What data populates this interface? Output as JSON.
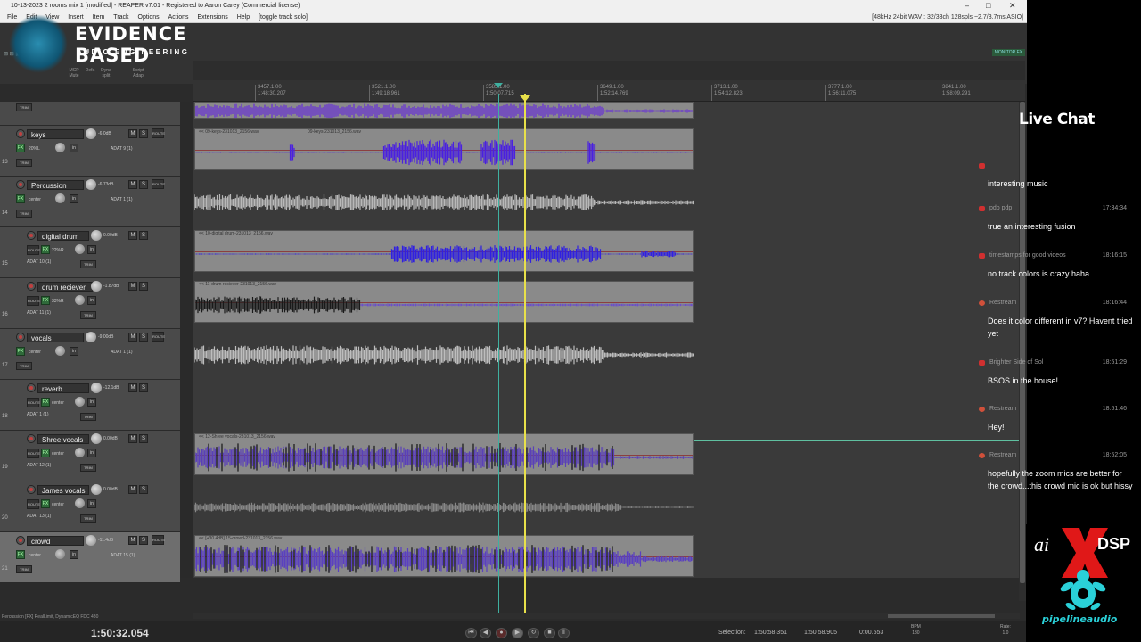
{
  "window": {
    "title": "10-13-2023 2 rooms mix 1 [modified] - REAPER v7.01 - Registered to Aaron Carey (Commercial license)",
    "format": "[48kHz 24bit WAV : 32/33ch 128spls ~2.7/3.7ms ASIO]"
  },
  "menu": [
    "File",
    "Edit",
    "View",
    "Insert",
    "Item",
    "Track",
    "Options",
    "Actions",
    "Extensions",
    "Help",
    "[toggle track solo]"
  ],
  "logo": {
    "title": "EVIDENCE BASED",
    "subtitle": "AUDIO ENGINEERING"
  },
  "toolbar": {
    "labels": [
      "MCP",
      "Mute",
      "Defa",
      "Dyna split",
      "Script Adap"
    ],
    "monitor": "MONITOR FX"
  },
  "ruler": [
    {
      "bar": "3457.1.00",
      "time": "1:48:30.207"
    },
    {
      "bar": "3521.1.00",
      "time": "1:49:18.961"
    },
    {
      "bar": "3585.1.00",
      "time": "1:50:07.715"
    },
    {
      "bar": "3649.1.00",
      "time": "1:52:14.769"
    },
    {
      "bar": "3713.1.00",
      "time": "1:54:12.823"
    },
    {
      "bar": "3777.1.00",
      "time": "1:56:11.075"
    },
    {
      "bar": "3841.1.00",
      "time": "1:58:09.291"
    }
  ],
  "tracks": [
    {
      "num": "13",
      "name": "keys",
      "db": "-6.0dB",
      "pan": "20%L",
      "input": "ADAT 9 (1)",
      "item": "<< 09-keys-231013_2156.wav",
      "item2": "09-keys-231013_2156.wav"
    },
    {
      "num": "14",
      "name": "Percussion",
      "db": "-6.73dB",
      "pan": "center",
      "input": "ADAT 1 (1)",
      "item": ""
    },
    {
      "num": "15",
      "name": "digital drum",
      "db": "0.00dB",
      "pan": "22%R",
      "input": "ADAT 10 (1)",
      "item": "<< 10-digital drum-231013_2156.wav"
    },
    {
      "num": "16",
      "name": "drum reciever",
      "db": "-1.87dB",
      "pan": "33%R",
      "input": "ADAT 11 (1)",
      "item": "<< 11-drum reciever-231013_2156.wav"
    },
    {
      "num": "17",
      "name": "vocals",
      "db": "-9.00dB",
      "pan": "center",
      "input": "ADAT 1 (1)",
      "item": ""
    },
    {
      "num": "18",
      "name": "reverb",
      "db": "-12.1dB",
      "pan": "center",
      "input": "ADAT 1 (1)",
      "item": ""
    },
    {
      "num": "19",
      "name": "Shree vocals",
      "db": "0.00dB",
      "pan": "center",
      "input": "ADAT 12 (1)",
      "item": "<< 12-Shree vocals-231013_2156.wav"
    },
    {
      "num": "20",
      "name": "James vocals",
      "db": "0.00dB",
      "pan": "center",
      "input": "ADAT 13 (1)",
      "item": ""
    },
    {
      "num": "21",
      "name": "crowd",
      "db": "-11.4dB",
      "pan": "center",
      "input": "ADAT 15 (1)",
      "item": "<< [+30.4dB] 15-crowd-231013_2156.wav"
    }
  ],
  "buttons": {
    "route": "ROUTE",
    "trim": "TRIM",
    "fx": "FX",
    "solo": "S",
    "mute": "M",
    "in": "in"
  },
  "status": {
    "line": "Percussion [FX] RealLimit, DynamicEQ FDC 480",
    "time": "1:50:32.054",
    "selection_label": "Selection:",
    "sel_start": "1:50:58.351",
    "sel_end": "1:50:58.905",
    "sel_len": "0:00.553",
    "bpm_label": "BPM",
    "bpm": "130",
    "rate_label": "Rate:",
    "rate": "1.0"
  },
  "chat": {
    "title": "Live Chat",
    "messages": [
      {
        "user": "",
        "time": "",
        "icon": "youtube-icon",
        "text": "interesting music"
      },
      {
        "user": "pdp pdp",
        "time": "17:34:34",
        "icon": "youtube-icon",
        "text": "true an interesting fusion"
      },
      {
        "user": "timestamps for good videos",
        "time": "18:16:15",
        "icon": "youtube-icon",
        "text": "no track colors is crazy haha"
      },
      {
        "user": "Restream",
        "time": "18:16:44",
        "icon": "restream-icon",
        "text": "Does it color different in v7? Havent tried yet"
      },
      {
        "user": "Brighter Side of Sol",
        "time": "18:51:29",
        "icon": "youtube-icon",
        "text": "BSOS in the house!"
      },
      {
        "user": "Restream",
        "time": "18:51:46",
        "icon": "restream-icon",
        "text": "Hey!"
      },
      {
        "user": "Restream",
        "time": "18:52:05",
        "icon": "restream-icon",
        "text": "hopefully the zoom mics are better for the crowd...this crowd mic is ok but hissy"
      }
    ]
  },
  "brand": {
    "ai": "ai",
    "dsp": "DSP",
    "pipeline": "pipelineaudio"
  },
  "colors": {
    "playcursor": "#e8e04a",
    "editcursor": "#3fb0a0",
    "waveform_blue": "#3a2fd8",
    "waveform_purple": "#7a40c8"
  }
}
